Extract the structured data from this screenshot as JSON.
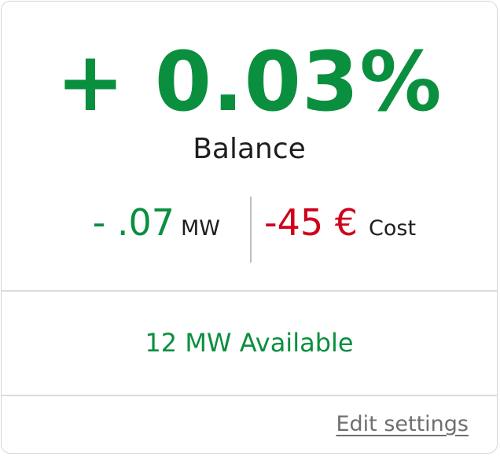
{
  "balance": {
    "percent_change": "+ 0.03%",
    "label": "Balance"
  },
  "stats": {
    "mw_delta": "- .07",
    "mw_unit": "MW",
    "cost_value": "-45 €",
    "cost_label": "Cost"
  },
  "capacity": {
    "available_text": "12 MW Available"
  },
  "actions": {
    "edit_settings_label": "Edit settings"
  },
  "colors": {
    "positive": "#0a8f3f",
    "negative": "#d0021b",
    "text": "#1e1e1e",
    "link": "#6f6f6f"
  }
}
